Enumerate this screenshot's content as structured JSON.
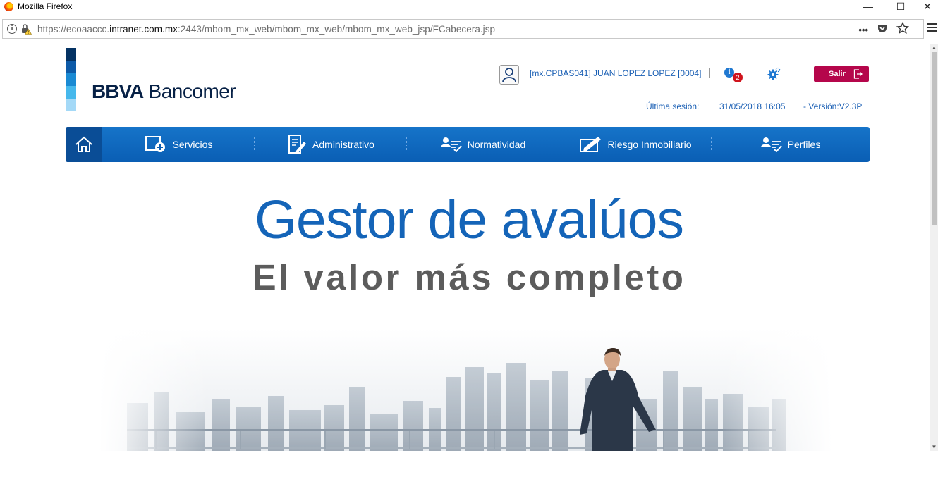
{
  "window": {
    "title": "Mozilla Firefox"
  },
  "browser": {
    "url_prefix": "https://ecoaaccc.",
    "url_domain": "intranet.com.mx",
    "url_rest": ":2443/mbom_mx_web/mbom_mx_web/mbom_mx_web_jsp/FCabecera.jsp",
    "more_label": "•••"
  },
  "brand": {
    "name_bold": "BBVA",
    "name_rest": " Bancomer",
    "stripes": [
      "#043263",
      "#0d5aa7",
      "#1a8ad3",
      "#46b8ec",
      "#a4d9f7"
    ]
  },
  "header": {
    "user": "[mx.CPBAS041] JUAN LOPEZ LOPEZ [0004]",
    "notifications": "2",
    "info_symbol": "i",
    "logout_label": "Salir",
    "last_session_label": "Última sesión:",
    "last_session_value": "31/05/2018 16:05",
    "version": "- Versión:V2.3P"
  },
  "menu": [
    {
      "label": "Servicios",
      "icon": "services-plus-icon"
    },
    {
      "label": "Administrativo",
      "icon": "document-edit-icon"
    },
    {
      "label": "Normatividad",
      "icon": "user-check-icon"
    },
    {
      "label": "Riesgo Inmobiliario",
      "icon": "screen-edit-icon"
    },
    {
      "label": "Perfiles",
      "icon": "user-check-icon"
    }
  ],
  "hero": {
    "title": "Gestor de avalúos",
    "subtitle": "El valor más completo",
    "image": "businessman-city-skyline"
  },
  "colors": {
    "brand_blue": "#1464b8",
    "menu_blue": "#0a5eb4",
    "logout": "#b5064b",
    "notification": "#d0141d"
  }
}
